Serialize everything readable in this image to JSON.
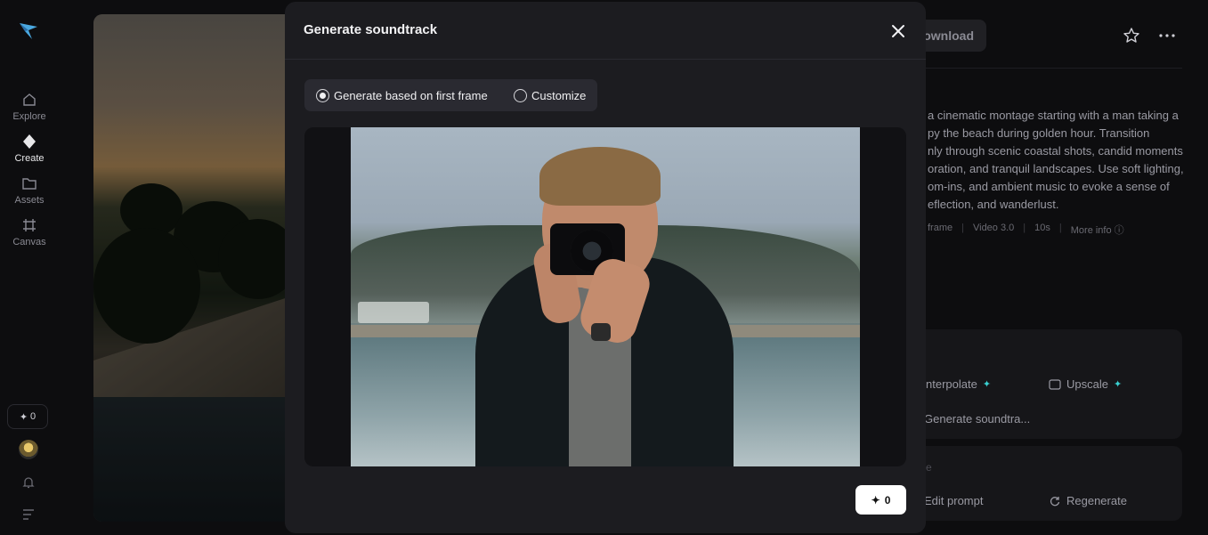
{
  "nav": {
    "items": [
      {
        "label": "Explore",
        "icon": "home-icon"
      },
      {
        "label": "Create",
        "icon": "diamond-icon"
      },
      {
        "label": "Assets",
        "icon": "folder-icon"
      },
      {
        "label": "Canvas",
        "icon": "grid-icon"
      }
    ],
    "credits": "0"
  },
  "right_panel": {
    "download_label": "Download",
    "description": "a cinematic montage starting with a man taking a\npy the beach during golden hour. Transition\nnly through scenic coastal shots, candid moments\noration, and tranquil landscapes. Use soft lighting,\nom-ins, and ambient music to evoke a sense of\neflection, and wanderlust.",
    "meta": [
      "frame",
      "Video 3.0",
      "10s",
      "More info"
    ],
    "tools": {
      "interpolate": "nterpolate",
      "upscale": "Upscale",
      "soundtrack": "Generate soundtra..."
    },
    "section_letter": "e",
    "actions": {
      "edit_prompt": "Edit prompt",
      "regenerate": "Regenerate"
    }
  },
  "modal": {
    "title": "Generate soundtrack",
    "options": {
      "first_frame": "Generate based on first frame",
      "customize": "Customize"
    },
    "selected_option": "first_frame",
    "generate_cost": "0"
  },
  "colors": {
    "background": "#0d0d0f",
    "modal": "#1c1c20",
    "accent": "#3ad0d0"
  }
}
